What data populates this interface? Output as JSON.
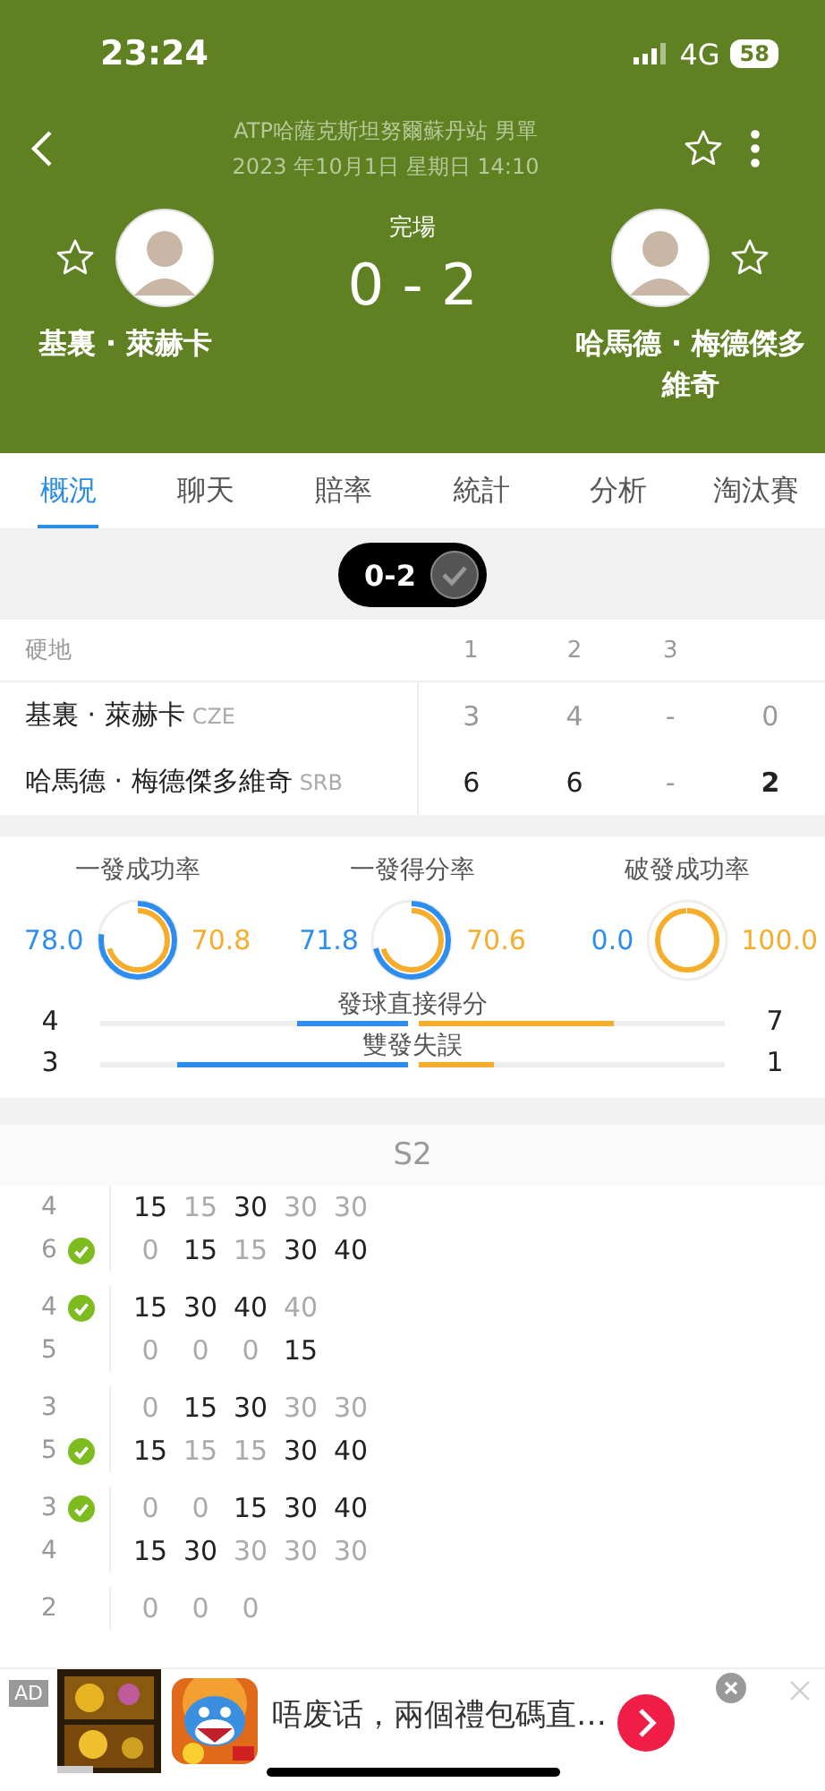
{
  "status_bar": {
    "time": "23:24",
    "network": "4G",
    "battery": "58"
  },
  "header": {
    "title": "ATP哈薩克斯坦努爾蘇丹站 男單",
    "datetime": "2023 年10月1日 星期日 14:10",
    "favorite": false,
    "status": "完場",
    "score": "0 - 2",
    "players": [
      {
        "name": "基裏 · 萊赫卡",
        "favorite": false
      },
      {
        "name": "哈馬德 · 梅德傑多維奇",
        "favorite": false
      }
    ]
  },
  "tabs": [
    {
      "label": "概況",
      "selected": true
    },
    {
      "label": "聊天",
      "selected": false
    },
    {
      "label": "賠率",
      "selected": false
    },
    {
      "label": "統計",
      "selected": false
    },
    {
      "label": "分析",
      "selected": false
    },
    {
      "label": "淘汰賽",
      "selected": false
    }
  ],
  "result_pill": {
    "score": "0-2"
  },
  "score_table": {
    "surface": "硬地",
    "set_headers": [
      "1",
      "2",
      "3"
    ],
    "rows": [
      {
        "name": "基裏 · 萊赫卡",
        "country": "CZE",
        "sets": [
          "3",
          "4",
          "-"
        ],
        "total": "0",
        "winner": false
      },
      {
        "name": "哈馬德 · 梅德傑多維奇",
        "country": "SRB",
        "sets": [
          "6",
          "6",
          "-"
        ],
        "total": "2",
        "winner": true
      }
    ]
  },
  "rings": [
    {
      "label": "一發成功率",
      "home": {
        "value": "78.0"
      },
      "away": {
        "value": "70.8"
      }
    },
    {
      "label": "一發得分率",
      "home": {
        "value": "71.8"
      },
      "away": {
        "value": "70.6"
      }
    },
    {
      "label": "破發成功率",
      "home": {
        "value": "0.0"
      },
      "away": {
        "value": "100.0"
      }
    }
  ],
  "bars": [
    {
      "label": "發球直接得分",
      "home": {
        "value": "4",
        "level": 0.36
      },
      "away": {
        "value": "7",
        "level": 0.64
      }
    },
    {
      "label": "雙發失誤",
      "home": {
        "value": "3",
        "level": 0.75
      },
      "away": {
        "value": "1",
        "level": 0.25
      }
    }
  ],
  "set_header": "S2",
  "games": [
    {
      "rows": [
        {
          "score": "4",
          "won": false,
          "points": [
            {
              "v": "15",
              "won": true
            },
            {
              "v": "15",
              "won": false
            },
            {
              "v": "30",
              "won": true
            },
            {
              "v": "30",
              "won": false
            },
            {
              "v": "30",
              "won": false
            }
          ]
        },
        {
          "score": "6",
          "won": true,
          "points": [
            {
              "v": "0",
              "won": false
            },
            {
              "v": "15",
              "won": true
            },
            {
              "v": "15",
              "won": false
            },
            {
              "v": "30",
              "won": true
            },
            {
              "v": "40",
              "won": true
            }
          ]
        }
      ]
    },
    {
      "rows": [
        {
          "score": "4",
          "won": true,
          "points": [
            {
              "v": "15",
              "won": true
            },
            {
              "v": "30",
              "won": true
            },
            {
              "v": "40",
              "won": true
            },
            {
              "v": "40",
              "won": false
            }
          ]
        },
        {
          "score": "5",
          "won": false,
          "points": [
            {
              "v": "0",
              "won": false
            },
            {
              "v": "0",
              "won": false
            },
            {
              "v": "0",
              "won": false
            },
            {
              "v": "15",
              "won": true
            }
          ]
        }
      ]
    },
    {
      "rows": [
        {
          "score": "3",
          "won": false,
          "points": [
            {
              "v": "0",
              "won": false
            },
            {
              "v": "15",
              "won": true
            },
            {
              "v": "30",
              "won": true
            },
            {
              "v": "30",
              "won": false
            },
            {
              "v": "30",
              "won": false
            }
          ]
        },
        {
          "score": "5",
          "won": true,
          "points": [
            {
              "v": "15",
              "won": true
            },
            {
              "v": "15",
              "won": false
            },
            {
              "v": "15",
              "won": false
            },
            {
              "v": "30",
              "won": true
            },
            {
              "v": "40",
              "won": true
            }
          ]
        }
      ]
    },
    {
      "rows": [
        {
          "score": "3",
          "won": true,
          "points": [
            {
              "v": "0",
              "won": false
            },
            {
              "v": "0",
              "won": false
            },
            {
              "v": "15",
              "won": true
            },
            {
              "v": "30",
              "won": true
            },
            {
              "v": "40",
              "won": true
            }
          ]
        },
        {
          "score": "4",
          "won": false,
          "points": [
            {
              "v": "15",
              "won": true
            },
            {
              "v": "30",
              "won": true
            },
            {
              "v": "30",
              "won": false
            },
            {
              "v": "30",
              "won": false
            },
            {
              "v": "30",
              "won": false
            }
          ]
        }
      ]
    },
    {
      "rows": [
        {
          "score": "2",
          "won": false,
          "points": [
            {
              "v": "0",
              "won": false
            },
            {
              "v": "0",
              "won": false
            },
            {
              "v": "0",
              "won": false
            }
          ]
        }
      ]
    }
  ],
  "ad": {
    "badge": "AD",
    "text": "唔废话，兩個禮包碼直…"
  }
}
